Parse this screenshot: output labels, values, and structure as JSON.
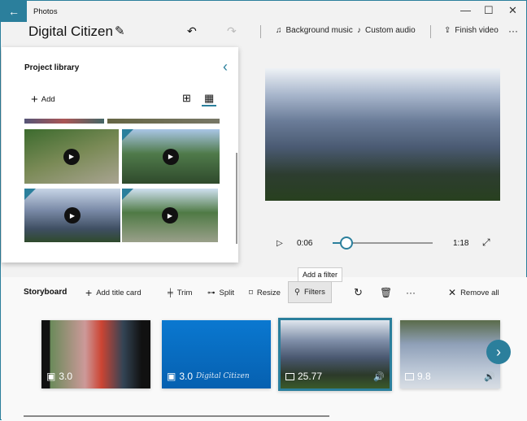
{
  "window": {
    "app_name": "Photos",
    "back": "←",
    "minimize": "—",
    "maximize": "☐",
    "close": "✕"
  },
  "header": {
    "project_title": "Digital Citizen",
    "background_music": "Background music",
    "custom_audio": "Custom audio",
    "finish_video": "Finish video",
    "more": "···"
  },
  "library": {
    "title": "Project library",
    "add": "Add",
    "collapse": "‹"
  },
  "player": {
    "current_time": "0:06",
    "total_time": "1:18",
    "progress": 0.06
  },
  "storyboard": {
    "title": "Storyboard",
    "add_title_card": "Add title card",
    "trim": "Trim",
    "split": "Split",
    "resize": "Resize",
    "filters": "Filters",
    "tooltip": "Add a filter",
    "more": "···",
    "remove_all": "Remove all",
    "clips": [
      {
        "duration": "3.0",
        "type": "photo"
      },
      {
        "duration": "3.0",
        "type": "title",
        "caption": "Digital Citizen"
      },
      {
        "duration": "25.77",
        "type": "video",
        "selected": true
      },
      {
        "duration": "9.8",
        "type": "video"
      }
    ]
  },
  "colors": {
    "accent": "#2b7f9c"
  }
}
